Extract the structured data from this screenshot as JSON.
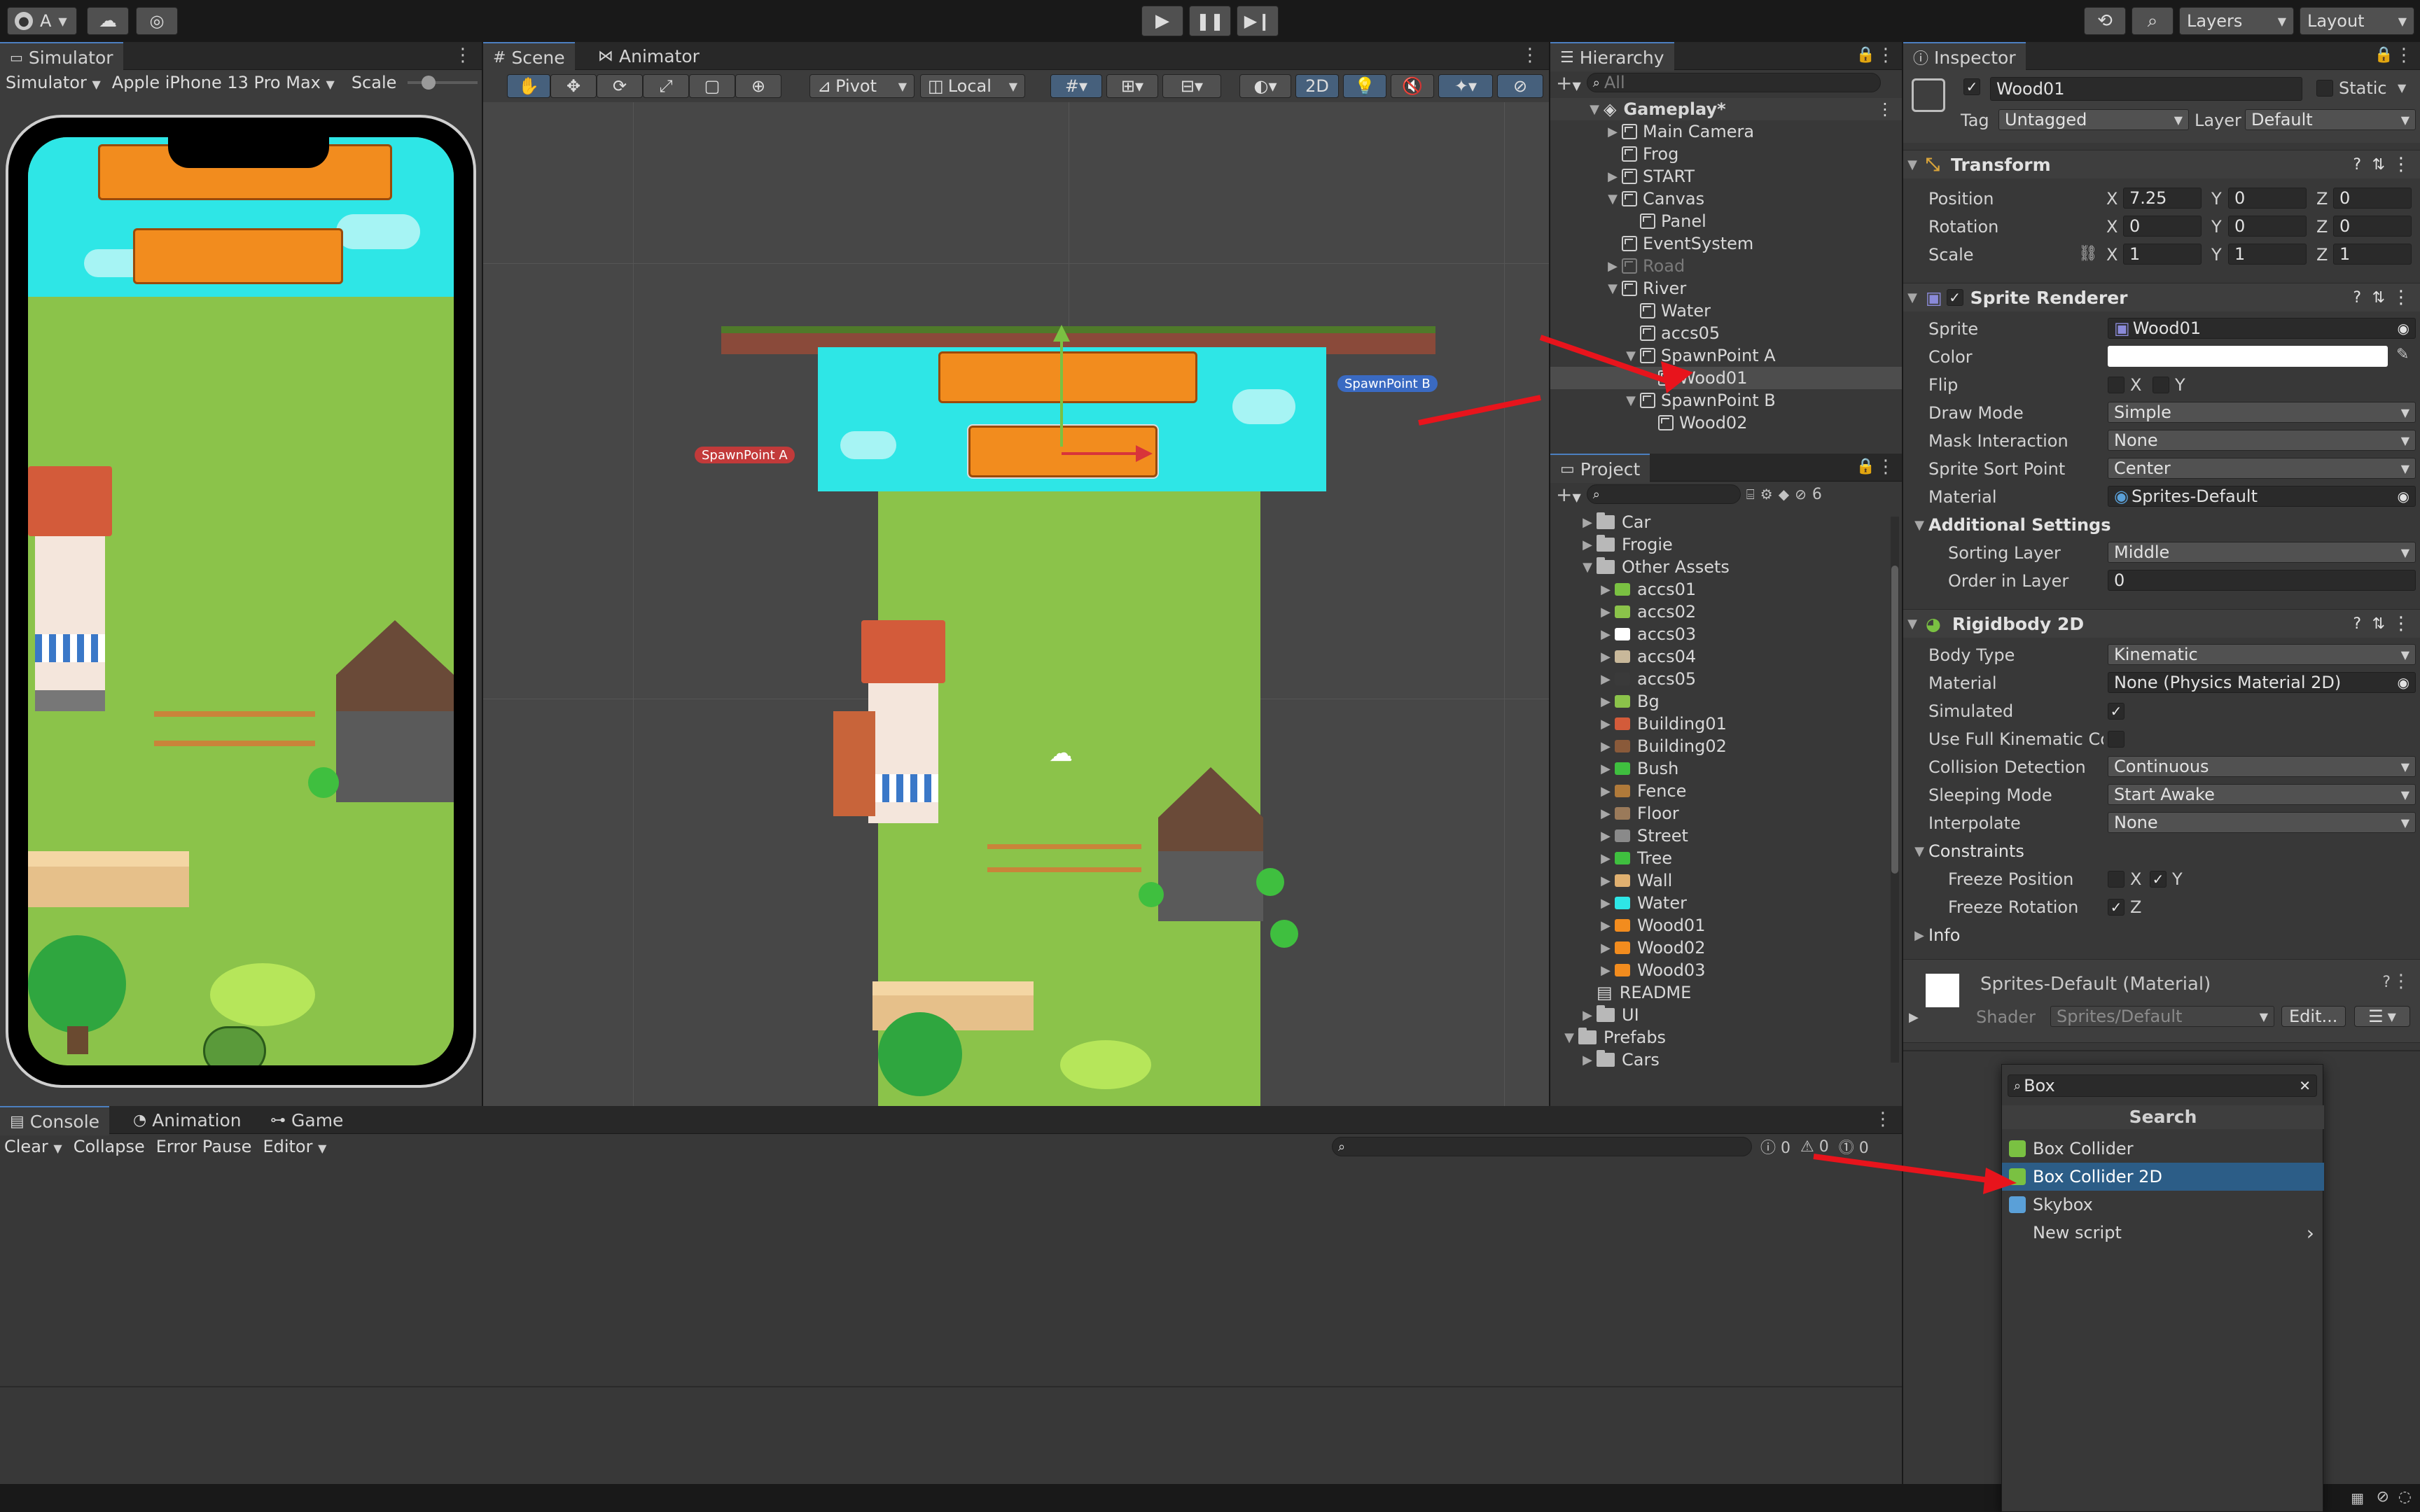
{
  "toolbar": {
    "account": "A",
    "layers": "Layers",
    "layout": "Layout"
  },
  "simulator": {
    "tab": "Simulator",
    "mode": "Simulator",
    "device": "Apple iPhone 13 Pro Max",
    "scale_label": "Scale"
  },
  "scene": {
    "tabs": [
      "Scene",
      "Animator"
    ],
    "pivot": "Pivot",
    "local": "Local",
    "mode2d": "2D",
    "spawn_a": "SpawnPoint A",
    "spawn_b": "SpawnPoint B"
  },
  "hierarchy": {
    "tab": "Hierarchy",
    "search_placeholder": "All",
    "items": [
      {
        "label": "Gameplay*",
        "depth": 0,
        "expanded": true,
        "bold": true
      },
      {
        "label": "Main Camera",
        "depth": 1,
        "expanded": false
      },
      {
        "label": "Frog",
        "depth": 1,
        "expanded": null
      },
      {
        "label": "START",
        "depth": 1,
        "expanded": false
      },
      {
        "label": "Canvas",
        "depth": 1,
        "expanded": true
      },
      {
        "label": "Panel",
        "depth": 2,
        "expanded": null
      },
      {
        "label": "EventSystem",
        "depth": 1,
        "expanded": null
      },
      {
        "label": "Road",
        "depth": 1,
        "expanded": false,
        "disabled": true
      },
      {
        "label": "River",
        "depth": 1,
        "expanded": true
      },
      {
        "label": "Water",
        "depth": 2,
        "expanded": null
      },
      {
        "label": "accs05",
        "depth": 2,
        "expanded": null
      },
      {
        "label": "SpawnPoint A",
        "depth": 2,
        "expanded": true
      },
      {
        "label": "Wood01",
        "depth": 3,
        "expanded": null,
        "selected": true
      },
      {
        "label": "SpawnPoint B",
        "depth": 2,
        "expanded": true
      },
      {
        "label": "Wood02",
        "depth": 3,
        "expanded": null
      }
    ]
  },
  "project": {
    "tab": "Project",
    "badge": "6",
    "items": [
      {
        "label": "Car",
        "depth": 1,
        "type": "folder"
      },
      {
        "label": "Frogie",
        "depth": 1,
        "type": "folder"
      },
      {
        "label": "Other Assets",
        "depth": 1,
        "type": "folder",
        "expanded": true
      },
      {
        "label": "accs01",
        "depth": 2,
        "type": "asset",
        "color": "#7ac142"
      },
      {
        "label": "accs02",
        "depth": 2,
        "type": "asset",
        "color": "#8bc34a"
      },
      {
        "label": "accs03",
        "depth": 2,
        "type": "asset",
        "color": "#ffffff"
      },
      {
        "label": "accs04",
        "depth": 2,
        "type": "asset",
        "color": "#c8b89a"
      },
      {
        "label": "accs05",
        "depth": 2,
        "type": "asset",
        "color": "#3a3a3a"
      },
      {
        "label": "Bg",
        "depth": 2,
        "type": "asset",
        "color": "#8bc34a"
      },
      {
        "label": "Building01",
        "depth": 2,
        "type": "asset",
        "color": "#d35b3a"
      },
      {
        "label": "Building02",
        "depth": 2,
        "type": "asset",
        "color": "#8a5a3a"
      },
      {
        "label": "Bush",
        "depth": 2,
        "type": "asset",
        "color": "#3fbf3f"
      },
      {
        "label": "Fence",
        "depth": 2,
        "type": "asset",
        "color": "#b07a3a"
      },
      {
        "label": "Floor",
        "depth": 2,
        "type": "asset",
        "color": "#9a7a5a"
      },
      {
        "label": "Street",
        "depth": 2,
        "type": "asset",
        "color": "#8a8a8a"
      },
      {
        "label": "Tree",
        "depth": 2,
        "type": "asset",
        "color": "#3fbf3f"
      },
      {
        "label": "Wall",
        "depth": 2,
        "type": "asset",
        "color": "#e0b070"
      },
      {
        "label": "Water",
        "depth": 2,
        "type": "asset",
        "color": "#2ee6e6"
      },
      {
        "label": "Wood01",
        "depth": 2,
        "type": "asset",
        "color": "#f28c1e"
      },
      {
        "label": "Wood02",
        "depth": 2,
        "type": "asset",
        "color": "#f28c1e"
      },
      {
        "label": "Wood03",
        "depth": 2,
        "type": "asset",
        "color": "#f28c1e"
      },
      {
        "label": "README",
        "depth": 1,
        "type": "doc"
      },
      {
        "label": "UI",
        "depth": 1,
        "type": "folder"
      },
      {
        "label": "Prefabs",
        "depth": 0,
        "type": "folder",
        "expanded": true
      },
      {
        "label": "Cars",
        "depth": 1,
        "type": "folder"
      }
    ]
  },
  "console": {
    "tabs": [
      "Console",
      "Animation",
      "Game"
    ],
    "clear": "Clear",
    "collapse": "Collapse",
    "error_pause": "Error Pause",
    "editor": "Editor",
    "counts": [
      "0",
      "0",
      "0"
    ]
  },
  "inspector": {
    "tab": "Inspector",
    "object_name": "Wood01",
    "static_label": "Static",
    "tag_label": "Tag",
    "tag_value": "Untagged",
    "layer_label": "Layer",
    "layer_value": "Default",
    "transform": {
      "title": "Transform",
      "position_label": "Position",
      "rotation_label": "Rotation",
      "scale_label": "Scale",
      "position": [
        "7.25",
        "0",
        "0"
      ],
      "rotation": [
        "0",
        "0",
        "0"
      ],
      "scale": [
        "1",
        "1",
        "1"
      ]
    },
    "sprite_renderer": {
      "title": "Sprite Renderer",
      "sprite_label": "Sprite",
      "sprite_value": "Wood01",
      "color_label": "Color",
      "flip_label": "Flip",
      "draw_mode_label": "Draw Mode",
      "draw_mode_value": "Simple",
      "mask_label": "Mask Interaction",
      "mask_value": "None",
      "sort_point_label": "Sprite Sort Point",
      "sort_point_value": "Center",
      "material_label": "Material",
      "material_value": "Sprites-Default",
      "additional": "Additional Settings",
      "sorting_layer_label": "Sorting Layer",
      "sorting_layer_value": "Middle",
      "order_label": "Order in Layer",
      "order_value": "0"
    },
    "rigidbody": {
      "title": "Rigidbody 2D",
      "body_type_label": "Body Type",
      "body_type_value": "Kinematic",
      "material_label": "Material",
      "material_value": "None (Physics Material 2D)",
      "simulated_label": "Simulated",
      "full_kinematic_label": "Use Full Kinematic Cor",
      "collision_label": "Collision Detection",
      "collision_value": "Continuous",
      "sleeping_label": "Sleeping Mode",
      "sleeping_value": "Start Awake",
      "interpolate_label": "Interpolate",
      "interpolate_value": "None",
      "constraints_label": "Constraints",
      "freeze_pos_label": "Freeze Position",
      "freeze_rot_label": "Freeze Rotation",
      "info_label": "Info"
    },
    "material": {
      "title": "Sprites-Default (Material)",
      "shader_label": "Shader",
      "shader_value": "Sprites/Default",
      "edit": "Edit..."
    }
  },
  "add_component": {
    "search_value": "Box",
    "header": "Search",
    "items": [
      {
        "label": "Box Collider",
        "icon_color": "#7ac142"
      },
      {
        "label": "Box Collider 2D",
        "icon_color": "#7ac142",
        "selected": true
      },
      {
        "label": "Skybox",
        "icon_color": "#5aa0d8"
      },
      {
        "label": "New script",
        "icon_color": ""
      }
    ]
  },
  "colors": {
    "accent": "#4c7fc0",
    "selection": "#2c5d87",
    "annotation_arrow": "#e8141c",
    "water": "#2ee6e6",
    "grass": "#8bc34a",
    "wood": "#f28c1e"
  }
}
